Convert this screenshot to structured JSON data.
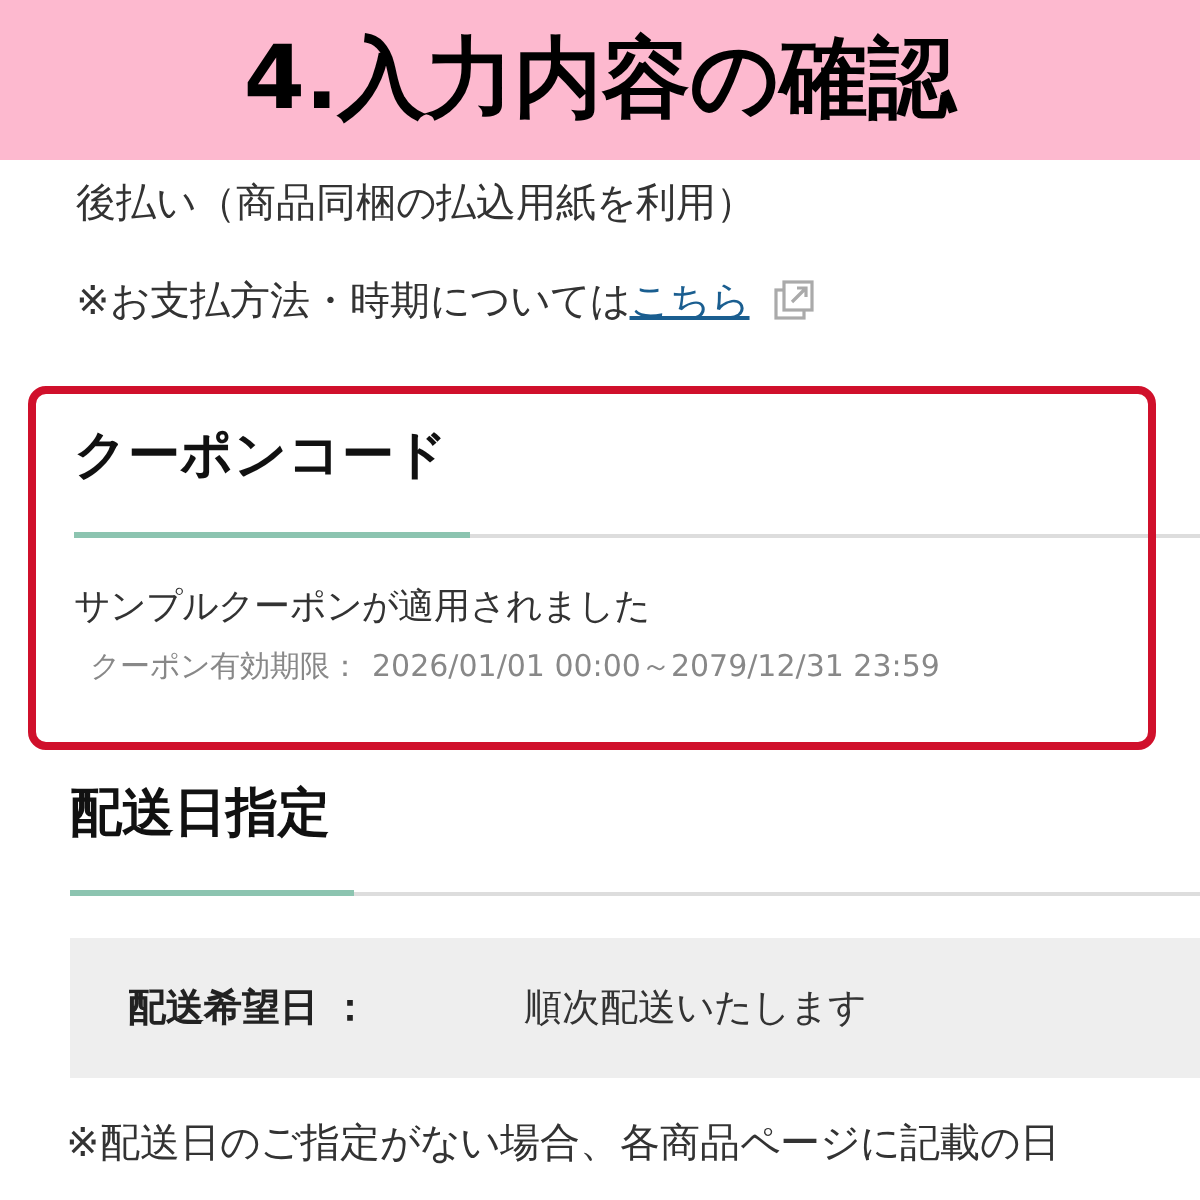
{
  "header": {
    "title": "4.入力内容の確認"
  },
  "payment": {
    "method": "後払い（商品同梱の払込用紙を利用）",
    "note": "※お支払方法・時期については",
    "link": "こちら"
  },
  "coupon": {
    "highlighted": true,
    "heading": "クーポンコード",
    "message": "サンプルクーポンが適用されました",
    "validity_label": "クーポン有効期限：",
    "validity": "2026/01/01 00:00～2079/12/31 23:59"
  },
  "delivery": {
    "heading": "配送日指定",
    "field_label": "配送希望日 ：",
    "field_value": "順次配送いたします",
    "note": "※配送日のご指定がない場合、各商品ページに記載の日"
  }
}
